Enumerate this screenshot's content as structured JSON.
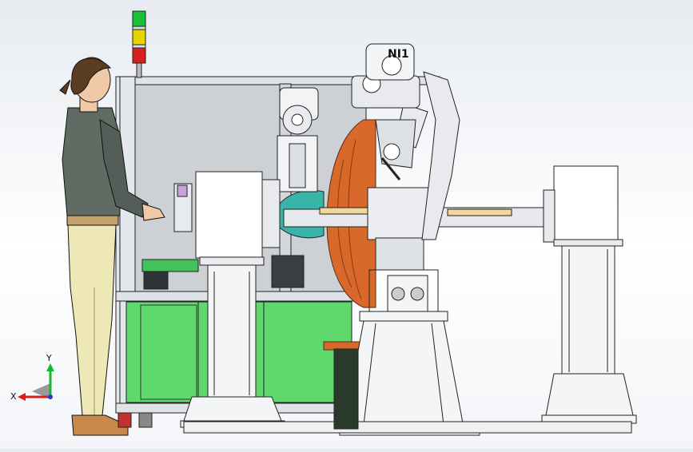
{
  "viewport": {
    "robot_label": "NI1",
    "triad": {
      "x_label": "X",
      "y_label": "Y"
    },
    "signal_tower": [
      "#19c137",
      "#e6d300",
      "#d81e1e"
    ],
    "colors": {
      "robot_orange": "#d8692a",
      "guard_green": "#5fd86e",
      "teal_disc": "#38b5a8",
      "frame_grey": "#c9ced6",
      "skin": "#f0c9a7"
    }
  }
}
